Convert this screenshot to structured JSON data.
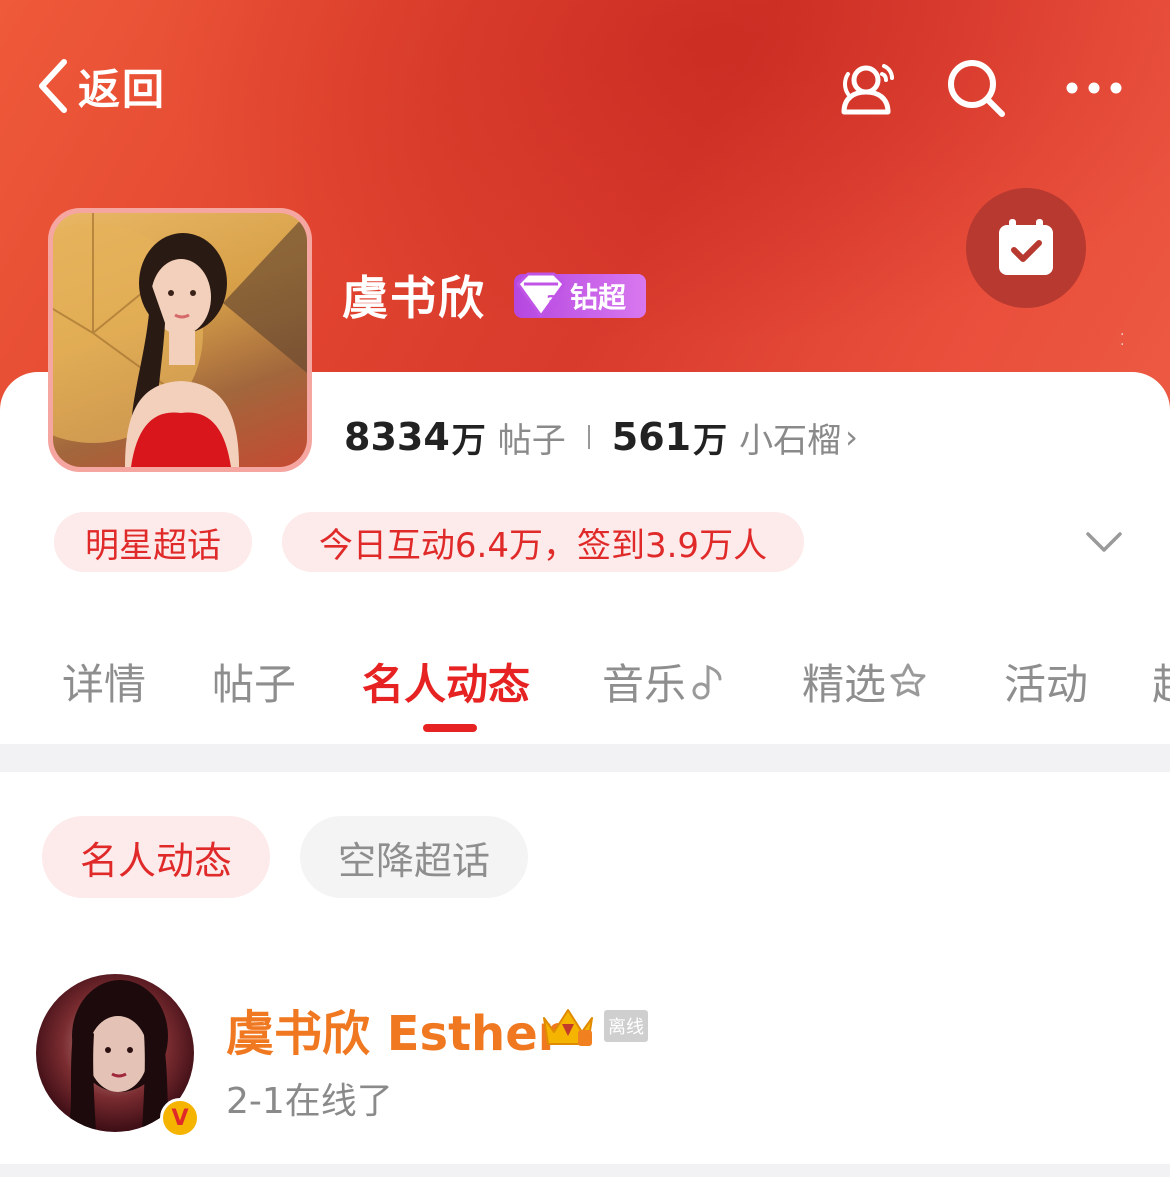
{
  "nav": {
    "back_label": "返回",
    "icons": [
      "people-voice-icon",
      "search-icon",
      "more-icon"
    ]
  },
  "topic": {
    "name": "虞书欣",
    "badge_level": "3",
    "badge_label": "钻超",
    "checkin_icon": "calendar-check-icon"
  },
  "stats": {
    "posts_num": "8334",
    "posts_unit": "万",
    "posts_label": "帖子",
    "fans_num": "561",
    "fans_unit": "万",
    "fans_label": "小石榴",
    "chevron": "›"
  },
  "pills": {
    "category": "明星超话",
    "today": "今日互动6.4万，签到3.9万人"
  },
  "tabs": [
    {
      "label": "详情"
    },
    {
      "label": "帖子"
    },
    {
      "label": "名人动态"
    },
    {
      "label": "音乐"
    },
    {
      "label": "精选"
    },
    {
      "label": "活动"
    },
    {
      "label": "超"
    }
  ],
  "active_tab_index": 2,
  "subtabs": {
    "active": "名人动态",
    "inactive": "空降超话"
  },
  "feed": {
    "name": "虞书欣 Esther",
    "offline_label": "离线",
    "status": "2-1在线了",
    "verified_label": "V"
  },
  "colors": {
    "accent": "#e62222",
    "header_red": "#e0432f",
    "orange_name": "#f07820",
    "pill_bg": "#fdeaea"
  }
}
